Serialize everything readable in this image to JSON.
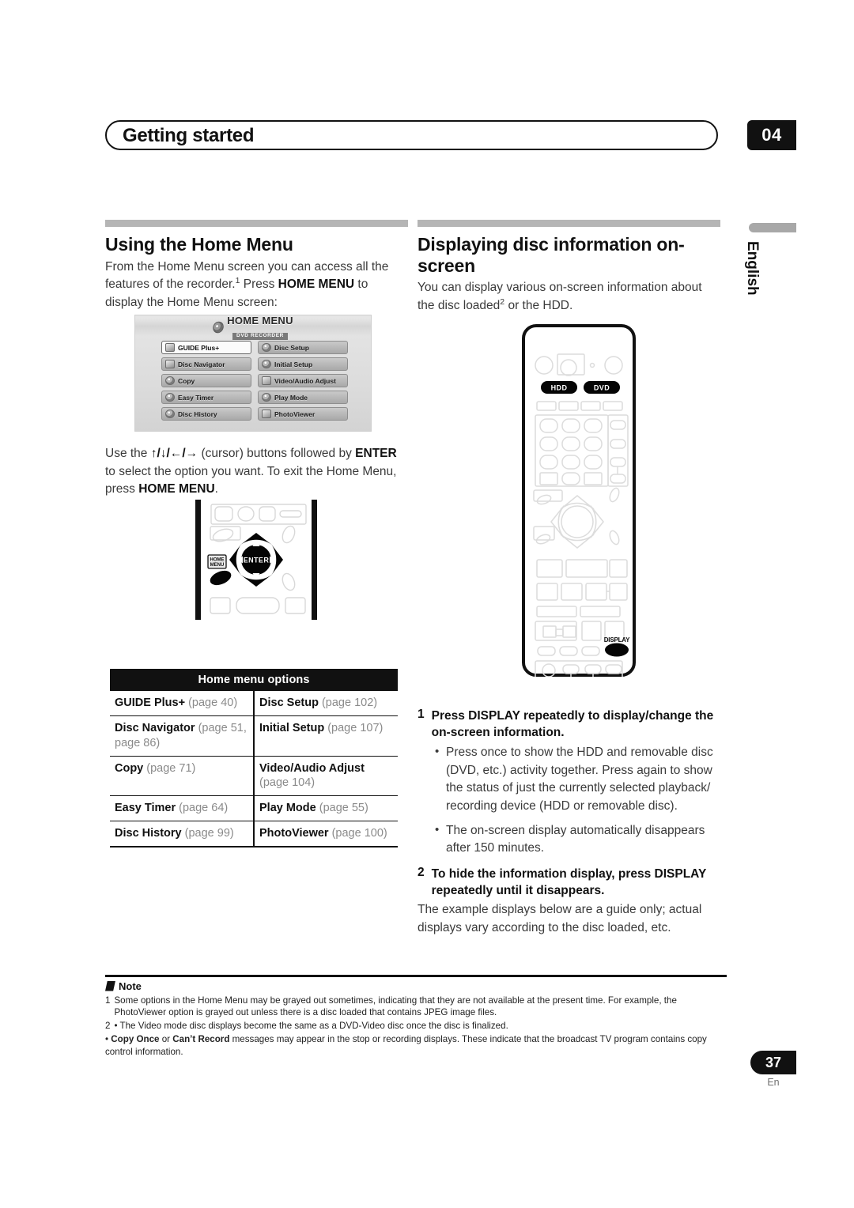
{
  "header": {
    "title": "Getting started",
    "chapter": "04"
  },
  "side_tab": {
    "label": "English"
  },
  "left_column": {
    "heading": "Using the Home Menu",
    "intro_1": "From the Home Menu screen you can access all the",
    "intro_2_a": "features of the recorder.",
    "intro_2_sup": "1",
    "intro_2_b": " Press ",
    "intro_2_bold": "HOME MENU",
    "intro_2_c": " to display",
    "intro_3": "the Home Menu screen:",
    "cursor_1": "Use the ",
    "cursor_arrows": "↑/↓/←/→",
    "cursor_2": " (cursor) buttons followed by ",
    "cursor_enter": "ENTER",
    "cursor_3": " to select the option you want. To exit the Home Menu, press ",
    "cursor_homemenu": "HOME MENU",
    "cursor_4": "."
  },
  "osd_screen": {
    "title_main": "HOME MENU",
    "title_sub": "DVD RECORDER",
    "disc_icon": "disc-icon",
    "items": [
      {
        "label": "GUIDE Plus+",
        "icon": "guide-icon",
        "selected": true
      },
      {
        "label": "Disc Setup",
        "icon": "disc-icon",
        "selected": false
      },
      {
        "label": "Disc Navigator",
        "icon": "navigator-icon",
        "selected": false
      },
      {
        "label": "Initial Setup",
        "icon": "setup-icon",
        "selected": false
      },
      {
        "label": "Copy",
        "icon": "copy-icon",
        "selected": false
      },
      {
        "label": "Video/Audio Adjust",
        "icon": "adjust-icon",
        "selected": false
      },
      {
        "label": "Easy Timer",
        "icon": "timer-icon",
        "selected": false
      },
      {
        "label": "Play Mode",
        "icon": "play-icon",
        "selected": false
      },
      {
        "label": "Disc History",
        "icon": "history-icon",
        "selected": false
      },
      {
        "label": "PhotoViewer",
        "icon": "photo-icon",
        "selected": false
      }
    ]
  },
  "remote_left": {
    "enter_label": "ENTER",
    "home_menu_label_1": "HOME",
    "home_menu_label_2": "MENU"
  },
  "remote_right": {
    "hdd_label": "HDD",
    "dvd_label": "DVD",
    "display_label": "DISPLAY"
  },
  "options_table": {
    "caption": "Home menu options",
    "rows": [
      [
        {
          "name": "GUIDE Plus+",
          "page": " (page 40)"
        },
        {
          "name": "Disc Setup",
          "page": " (page 102)"
        }
      ],
      [
        {
          "name": "Disc Navigator",
          "page": " (page 51, page 86)"
        },
        {
          "name": "Initial Setup",
          "page": " (page 107)"
        }
      ],
      [
        {
          "name": "Copy",
          "page": " (page 71)"
        },
        {
          "name": "Video/Audio Adjust",
          "page": " (page 104)"
        }
      ],
      [
        {
          "name": "Easy Timer",
          "page": " (page 64)"
        },
        {
          "name": "Play Mode",
          "page": " (page 55)"
        }
      ],
      [
        {
          "name": "Disc History",
          "page": " (page 99)"
        },
        {
          "name": "PhotoViewer",
          "page": " (page 100)"
        }
      ]
    ]
  },
  "right_column": {
    "heading_line1": "Displaying disc information on-",
    "heading_line2": "screen",
    "intro_1": "You can display various on-screen information about the",
    "intro_2_a": "disc loaded",
    "intro_2_sup": "2",
    "intro_2_b": " or the HDD.",
    "step1_num": "1",
    "step1_text": "Press DISPLAY repeatedly to display/change the on-screen information.",
    "step1_bullet1": "Press once to show the HDD and removable disc (DVD, etc.) activity together. Press again to show the status of just the currently selected playback/ recording device (HDD or removable disc).",
    "step1_bullet2": "The on-screen display automatically disappears after 150 minutes.",
    "step2_num": "2",
    "step2_text": "To hide the information display, press DISPLAY repeatedly until it disappears.",
    "step2_body": "The example displays below are a guide only; actual displays vary according to the disc loaded, etc."
  },
  "notes": {
    "title": "Note",
    "items": [
      {
        "index": "1",
        "text": "Some options in the Home Menu may be grayed out sometimes, indicating that they are not available at the present time. For example, the PhotoViewer option is grayed out unless there is a disc loaded that contains JPEG image files."
      },
      {
        "index": "2",
        "text": "• The Video mode disc displays become the same as a DVD-Video disc once the disc is finalized."
      }
    ],
    "sub_bullet_prefix": "• ",
    "sub_bullet_bold_1": "Copy Once",
    "sub_bullet_mid": " or ",
    "sub_bullet_bold_2": "Can’t Record",
    "sub_bullet_rest": " messages may appear in the stop or recording displays. These indicate that the broadcast TV program contains copy control information."
  },
  "footer": {
    "page_number": "37",
    "language": "En"
  }
}
